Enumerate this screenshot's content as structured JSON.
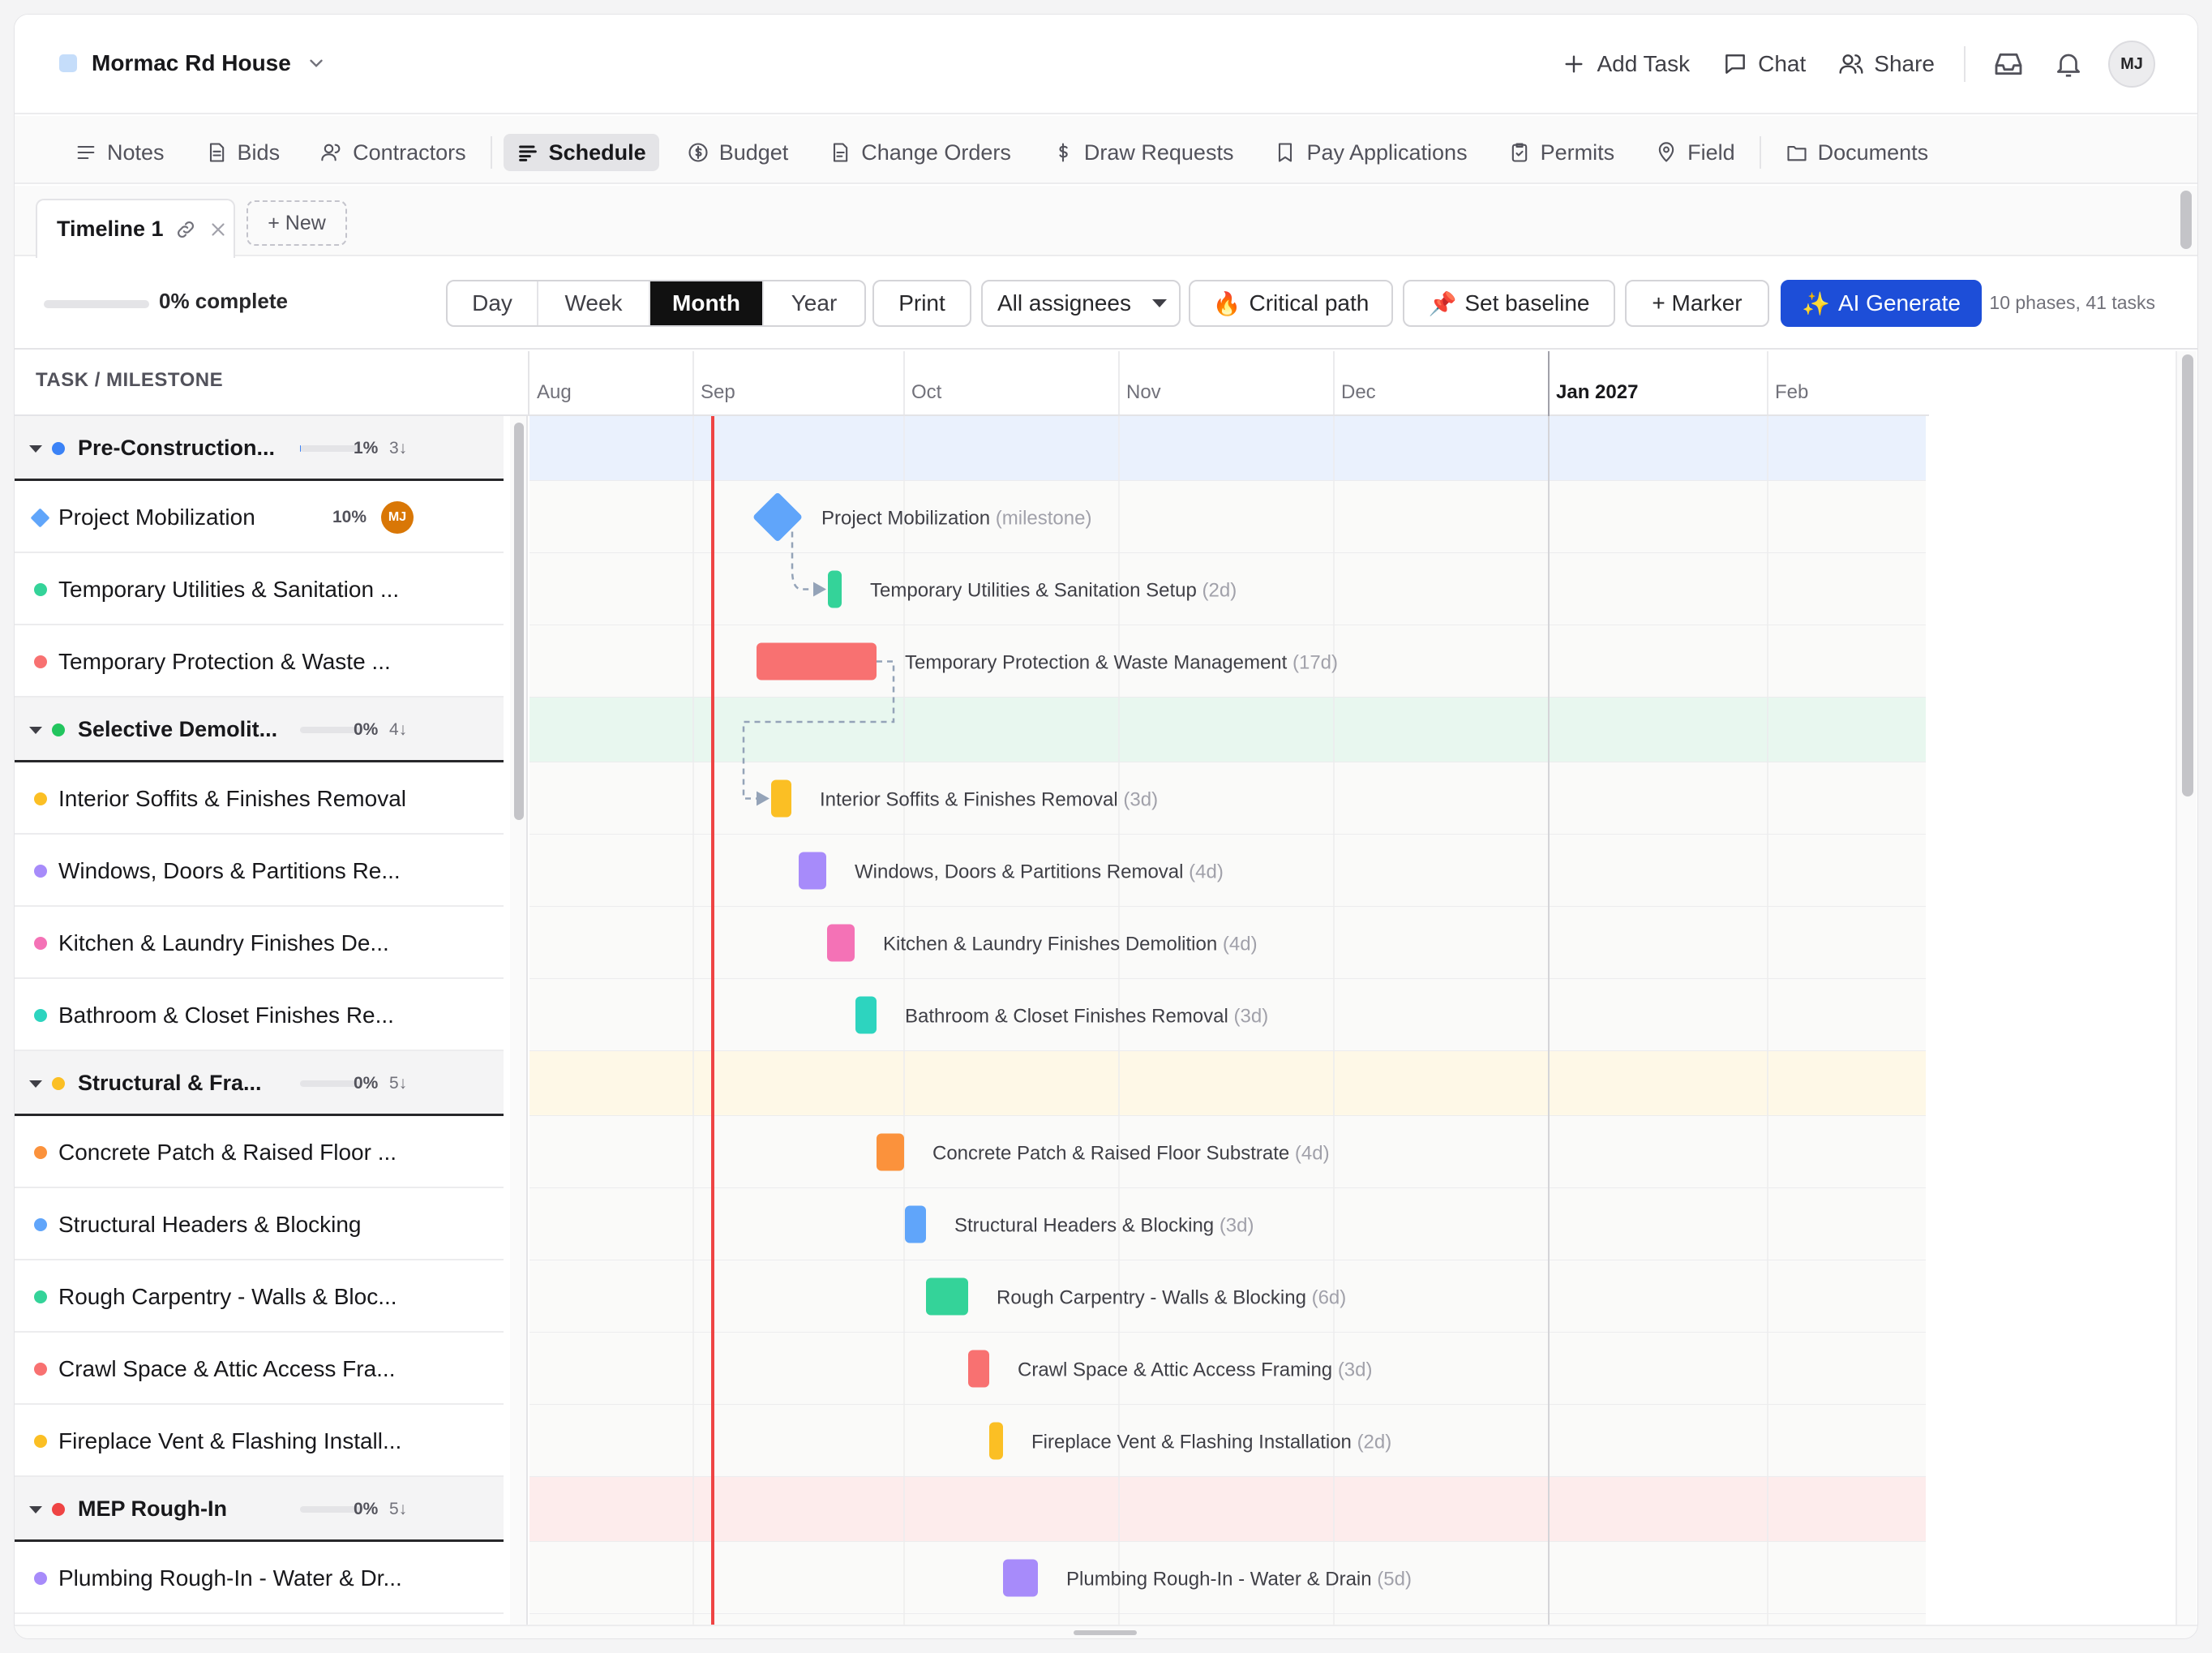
{
  "project": {
    "name": "Mormac Rd House"
  },
  "top_actions": {
    "add_task": "Add Task",
    "chat": "Chat",
    "share": "Share",
    "avatar": "MJ"
  },
  "nav": [
    {
      "label": "Notes",
      "icon": "notes-icon",
      "active": false
    },
    {
      "label": "Bids",
      "icon": "bids-icon",
      "active": false
    },
    {
      "label": "Contractors",
      "icon": "contractors-icon",
      "active": false
    },
    {
      "label": "Schedule",
      "icon": "schedule-icon",
      "active": true
    },
    {
      "label": "Budget",
      "icon": "budget-icon",
      "active": false
    },
    {
      "label": "Change Orders",
      "icon": "change-orders-icon",
      "active": false
    },
    {
      "label": "Draw Requests",
      "icon": "dollar-icon",
      "active": false
    },
    {
      "label": "Pay Applications",
      "icon": "pay-applications-icon",
      "active": false
    },
    {
      "label": "Permits",
      "icon": "permits-icon",
      "active": false
    },
    {
      "label": "Field",
      "icon": "pin-icon",
      "active": false
    },
    {
      "label": "Documents",
      "icon": "folder-icon",
      "active": false
    }
  ],
  "timeline_tabs": {
    "active": "Timeline 1",
    "new_label": "+ New"
  },
  "toolbar": {
    "progress_pct": 0,
    "progress_text": "0% complete",
    "views": [
      "Day",
      "Week",
      "Month",
      "Year"
    ],
    "active_view": "Month",
    "print": "Print",
    "assignees": "All assignees",
    "critical_path": "Critical path",
    "critical_icon": "🔥",
    "set_baseline": "Set baseline",
    "baseline_icon": "📌",
    "marker": "+ Marker",
    "ai_generate": "AI Generate",
    "ai_icon": "✨",
    "summary": "10 phases, 41 tasks"
  },
  "left_header": "TASK / MILESTONE",
  "months": [
    {
      "label": "Aug",
      "bold": false
    },
    {
      "label": "Sep",
      "bold": false
    },
    {
      "label": "Oct",
      "bold": false
    },
    {
      "label": "Nov",
      "bold": false
    },
    {
      "label": "Dec",
      "bold": false
    },
    {
      "label": "Jan 2027",
      "bold": true
    },
    {
      "label": "Feb",
      "bold": false
    }
  ],
  "rows": [
    {
      "type": "phase",
      "name": "Pre-Construction...",
      "color": "#3b82f6",
      "pct": "1%",
      "progress": 0.01,
      "count": "3↓",
      "band": "#eaf1fd"
    },
    {
      "type": "milestone",
      "name": "Project Mobilization",
      "color": "#60a5fa",
      "pct": "10%",
      "avatar": "MJ",
      "bar_label": "Project Mobilization",
      "bar_suffix": "(milestone)"
    },
    {
      "type": "task",
      "name": "Temporary Utilities & Sanitation ...",
      "color": "#34d399",
      "bar_label": "Temporary Utilities & Sanitation Setup",
      "bar_suffix": "(2d)"
    },
    {
      "type": "task",
      "name": "Temporary Protection & Waste ...",
      "color": "#f87171",
      "bar_label": "Temporary Protection & Waste Management",
      "bar_suffix": "(17d)"
    },
    {
      "type": "phase",
      "name": "Selective Demolit...",
      "color": "#22c55e",
      "pct": "0%",
      "progress": 0,
      "count": "4↓",
      "band": "#e8f7ef"
    },
    {
      "type": "task",
      "name": "Interior Soffits & Finishes Removal",
      "color": "#fbbf24",
      "bar_label": "Interior Soffits & Finishes Removal",
      "bar_suffix": "(3d)"
    },
    {
      "type": "task",
      "name": "Windows, Doors & Partitions Re...",
      "color": "#a78bfa",
      "bar_label": "Windows, Doors & Partitions Removal",
      "bar_suffix": "(4d)"
    },
    {
      "type": "task",
      "name": "Kitchen & Laundry Finishes De...",
      "color": "#f472b6",
      "bar_label": "Kitchen & Laundry Finishes Demolition",
      "bar_suffix": "(4d)"
    },
    {
      "type": "task",
      "name": "Bathroom & Closet Finishes Re...",
      "color": "#2dd4bf",
      "bar_label": "Bathroom & Closet Finishes Removal",
      "bar_suffix": "(3d)"
    },
    {
      "type": "phase",
      "name": "Structural & Fra...",
      "color": "#fbbf24",
      "pct": "0%",
      "progress": 0,
      "count": "5↓",
      "band": "#fef8e7"
    },
    {
      "type": "task",
      "name": "Concrete Patch & Raised Floor ...",
      "color": "#fb923c",
      "bar_label": "Concrete Patch & Raised Floor Substrate",
      "bar_suffix": "(4d)"
    },
    {
      "type": "task",
      "name": "Structural Headers & Blocking",
      "color": "#60a5fa",
      "bar_label": "Structural Headers & Blocking",
      "bar_suffix": "(3d)"
    },
    {
      "type": "task",
      "name": "Rough Carpentry - Walls & Bloc...",
      "color": "#34d399",
      "bar_label": "Rough Carpentry - Walls & Blocking",
      "bar_suffix": "(6d)"
    },
    {
      "type": "task",
      "name": "Crawl Space & Attic Access Fra...",
      "color": "#f87171",
      "bar_label": "Crawl Space & Attic Access Framing",
      "bar_suffix": "(3d)"
    },
    {
      "type": "task",
      "name": "Fireplace Vent & Flashing Install...",
      "color": "#fbbf24",
      "bar_label": "Fireplace Vent & Flashing Installation",
      "bar_suffix": "(2d)"
    },
    {
      "type": "phase",
      "name": "MEP Rough-In",
      "color": "#ef4444",
      "pct": "0%",
      "progress": 0,
      "count": "5↓",
      "band": "#fdecec"
    },
    {
      "type": "task",
      "name": "Plumbing Rough-In - Water & Dr...",
      "color": "#a78bfa",
      "bar_label": "Plumbing Rough-In - Water & Drain",
      "bar_suffix": "(5d)"
    },
    {
      "type": "task",
      "name": "",
      "color": "#f472b6",
      "bar_label": "",
      "bar_suffix": ""
    }
  ]
}
